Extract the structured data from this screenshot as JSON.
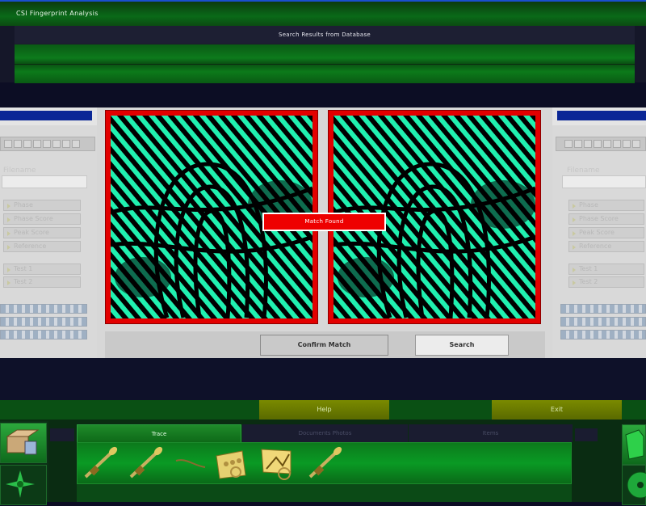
{
  "app": {
    "title": "CSI Fingerprint Analysis"
  },
  "results": {
    "title": "Search Results from Database"
  },
  "left_panel": {
    "filename_label": "Filename",
    "options": [
      "Phase",
      "Phase Score",
      "Peak Score",
      "Reference"
    ],
    "tests": [
      "Test 1",
      "Test 2"
    ]
  },
  "right_panel": {
    "filename_label": "Filename",
    "options": [
      "Phase",
      "Phase Score",
      "Peak Score",
      "Reference"
    ],
    "tests": [
      "Test 1",
      "Test 2"
    ]
  },
  "compare": {
    "status": "Match Found"
  },
  "actions": {
    "confirm": "Confirm Match",
    "search": "Search"
  },
  "menu": {
    "help": "Help",
    "exit": "Exit"
  },
  "tabs": [
    "Trace",
    "Documents Photos",
    "Items"
  ],
  "evidence_items": [
    "swab-icon",
    "swab-icon",
    "hair-fiber-icon",
    "fingerprint-card-icon",
    "fingerprint-card-icon",
    "swab-icon"
  ],
  "colors": {
    "match": "#e30000",
    "ridge": "#20f0b0",
    "accent_green": "#0a7a1a"
  }
}
